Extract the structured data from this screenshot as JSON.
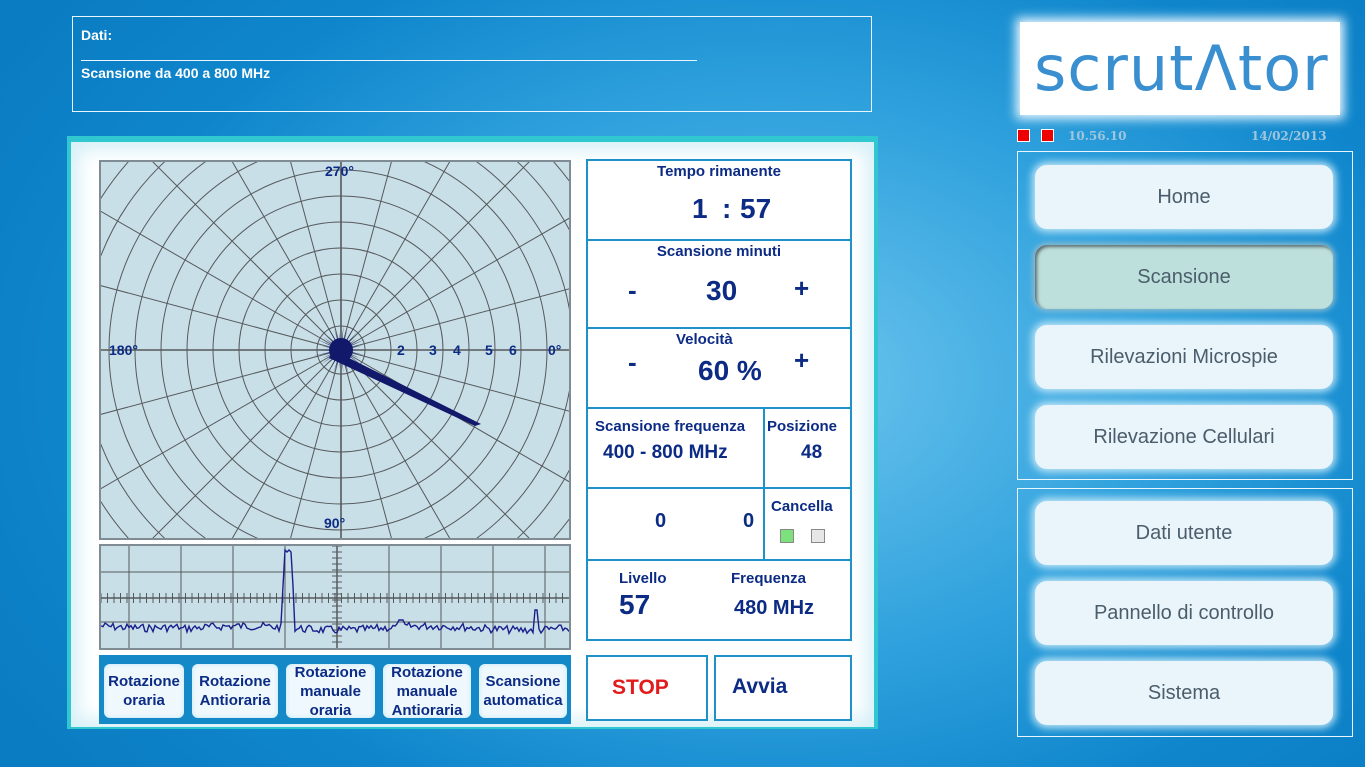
{
  "info": {
    "title": "Dati:",
    "description": "Scansione da 400 a 800 MHz"
  },
  "radar": {
    "angle_labels": {
      "top": "270°",
      "left": "180°",
      "right": "0°",
      "bottom": "90°"
    },
    "ring_labels": [
      "2",
      "3",
      "4",
      "5",
      "6"
    ]
  },
  "rotation_buttons": [
    {
      "label": "Rotazione oraria"
    },
    {
      "label": "Rotazione Antioraria"
    },
    {
      "label": "Rotazione manuale oraria"
    },
    {
      "label": "Rotazione manuale Antioraria"
    },
    {
      "label": "Scansione automatica"
    }
  ],
  "panel": {
    "tempo_label": "Tempo rimanente",
    "tempo_hours": "1",
    "tempo_sep": ":",
    "tempo_minutes": "57",
    "scan_min_label": "Scansione minuti",
    "scan_min_value": "30",
    "minus": "-",
    "plus": "+",
    "velocita_label": "Velocità",
    "velocita_value": "60 %",
    "freq_scan_label": "Scansione frequenza",
    "freq_scan_value": "400 - 800 MHz",
    "posizione_label": "Posizione",
    "posizione_value": "48",
    "counter_a": "0",
    "counter_b": "0",
    "cancella_label": "Cancella",
    "livello_label": "Livello",
    "livello_value": "57",
    "frequenza_label": "Frequenza",
    "frequenza_value": "480 MHz",
    "stop_label": "STOP",
    "avvia_label": "Avvia"
  },
  "logo": {
    "text": "scrutΛtor"
  },
  "status": {
    "time": "10.56.10",
    "date": "14/02/2013"
  },
  "nav_top": [
    {
      "label": "Home",
      "active": false
    },
    {
      "label": "Scansione",
      "active": true
    },
    {
      "label": "Rilevazioni Microspie",
      "active": false
    },
    {
      "label": "Rilevazione Cellulari",
      "active": false
    }
  ],
  "nav_bottom": [
    {
      "label": "Dati utente"
    },
    {
      "label": "Pannello di controllo"
    },
    {
      "label": "Sistema"
    }
  ],
  "colors": {
    "accent": "#0c2b84",
    "stop": "#e21b1b",
    "active_nav": "#bde0dc",
    "led": "#e00000",
    "checkbox_on": "#7ce07c"
  }
}
